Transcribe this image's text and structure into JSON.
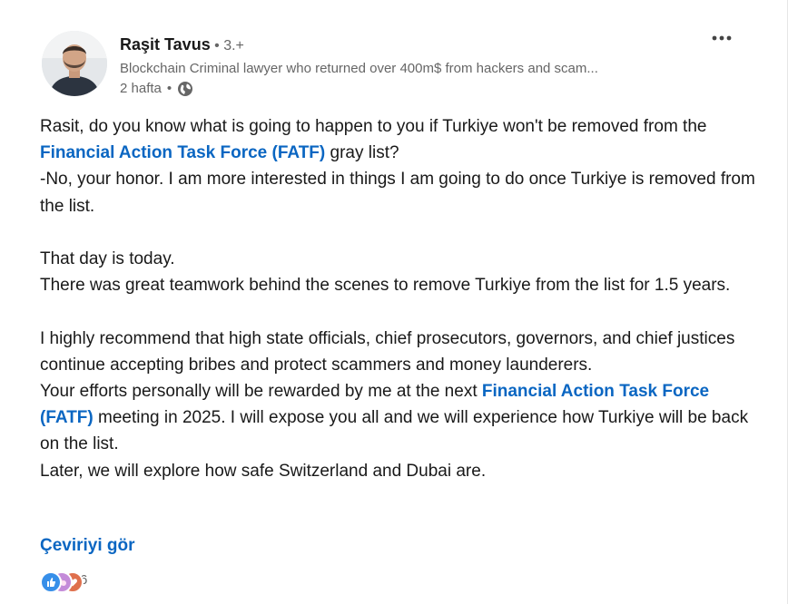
{
  "author": {
    "name": "Raşit Tavus",
    "separator": " • ",
    "degree": "3.+",
    "headline": "Blockchain Criminal lawyer who returned over 400m$ from hackers and scam...",
    "time": "2 hafta",
    "time_separator": " • ",
    "visibility_icon": "globe-icon"
  },
  "post": {
    "p1_pre": "Rasit, do you know what is going to happen to you if Turkiye won't be removed from the ",
    "p1_link": "Financial Action Task Force (FATF)",
    "p1_post": " gray list?",
    "p2": "-No, your honor. I am more interested in things I am going to do once Turkiye is removed from the list.",
    "p3": "That day is today.",
    "p4": "There was great teamwork behind the scenes to remove Turkiye from the list for 1.5 years.",
    "p5": "I highly recommend that high state officials, chief prosecutors, governors, and chief justices continue accepting bribes and protect scammers and money launderers.",
    "p6_pre": "Your efforts personally will be rewarded by me at the next ",
    "p6_link": "Financial Action Task Force (FATF)",
    "p6_post": " meeting in 2025. I will expose you all and we will experience how Turkiye will be back on the list.",
    "p7": "Later, we will explore how safe Switzerland and Dubai are."
  },
  "translate_label": "Çeviriyi gör",
  "reactions": {
    "icons": [
      "like-icon",
      "support-icon",
      "love-icon"
    ],
    "count": "6"
  },
  "colors": {
    "link": "#0a66c2",
    "text": "#191919",
    "muted": "#666666"
  }
}
